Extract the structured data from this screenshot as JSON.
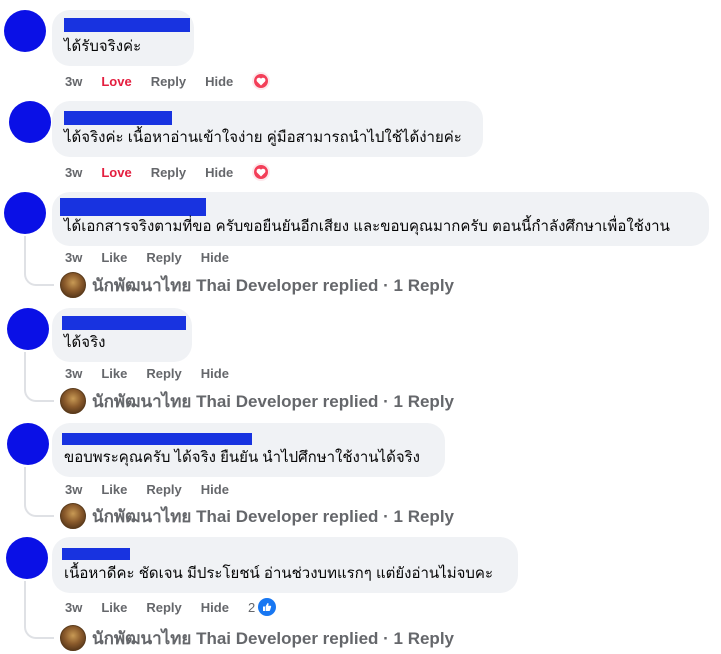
{
  "comments": [
    {
      "text": "ได้รับจริงค่ะ",
      "time": "3w",
      "reaction_action": "Love",
      "reply": "Reply",
      "hide": "Hide",
      "reaction_icon": "heart-icon"
    },
    {
      "text": "ได้จริงค่ะ เนื้อหาอ่านเข้าใจง่าย คู่มือสามารถนำไปใช้ได้ง่ายค่ะ",
      "time": "3w",
      "reaction_action": "Love",
      "reply": "Reply",
      "hide": "Hide",
      "reaction_icon": "heart-icon"
    },
    {
      "text": "ได้เอกสารจริงตามที่ขอ ครับขอยืนยันอีกเสียง และขอบคุณมากครับ ตอนนี้กำลังศึกษาเพื่อใช้งาน",
      "time": "3w",
      "reaction_action": "Like",
      "reply": "Reply",
      "hide": "Hide",
      "replies_text": "นักพัฒนาไทย Thai Developer replied · 1 Reply"
    },
    {
      "text": "ได้จริง",
      "time": "3w",
      "reaction_action": "Like",
      "reply": "Reply",
      "hide": "Hide",
      "replies_text": "นักพัฒนาไทย Thai Developer replied · 1 Reply"
    },
    {
      "text": "ขอบพระคุณครับ ได้จริง ยืนยัน นำไปศึกษาใช้งานได้จริง",
      "time": "3w",
      "reaction_action": "Like",
      "reply": "Reply",
      "hide": "Hide",
      "replies_text": "นักพัฒนาไทย Thai Developer replied · 1 Reply"
    },
    {
      "text": "เนื้อหาดีคะ ชัดเจน มีประโยชน์ อ่านช่วงบทแรกๆ แต่ยังอ่านไม่จบคะ",
      "time": "3w",
      "reaction_action": "Like",
      "reply": "Reply",
      "hide": "Hide",
      "reaction_count": "2",
      "reaction_icon": "like-icon",
      "replies_text": "นักพัฒนาไทย Thai Developer replied · 1 Reply"
    }
  ],
  "colors": {
    "avatar": "#0a10e6",
    "redaction": "#1833e0",
    "bubble": "#f0f2f5",
    "love": "#e41e3f",
    "muted": "#65676b",
    "like_blue": "#1877f2"
  }
}
